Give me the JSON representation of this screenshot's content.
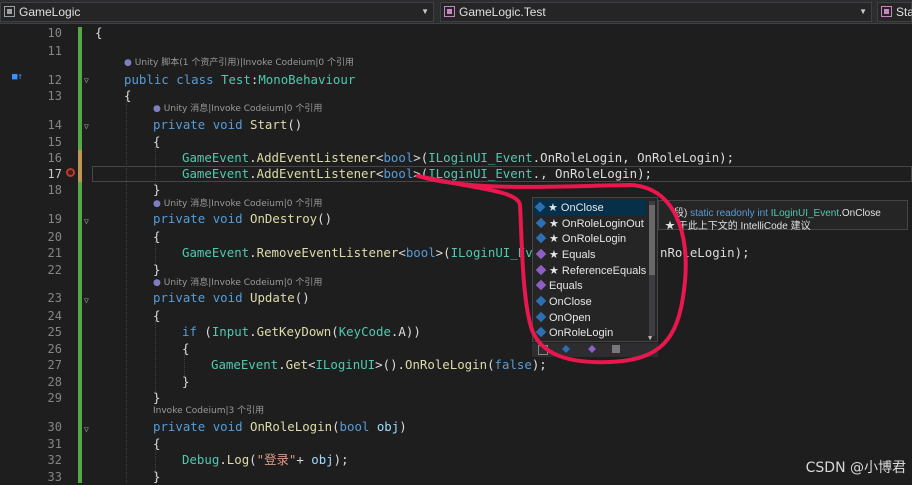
{
  "tabs": {
    "project": "GameLogic",
    "type": "GameLogic.Test",
    "member": "Sta"
  },
  "lines": [
    {
      "n": "10"
    },
    {
      "n": "11"
    },
    {
      "n": "12"
    },
    {
      "n": "13"
    },
    {
      "n": "14"
    },
    {
      "n": "15"
    },
    {
      "n": "16"
    },
    {
      "n": "17"
    },
    {
      "n": "18"
    },
    {
      "n": "19"
    },
    {
      "n": "20"
    },
    {
      "n": "21"
    },
    {
      "n": "22"
    },
    {
      "n": "23"
    },
    {
      "n": "24"
    },
    {
      "n": "25"
    },
    {
      "n": "26"
    },
    {
      "n": "27"
    },
    {
      "n": "28"
    },
    {
      "n": "29"
    },
    {
      "n": "30"
    },
    {
      "n": "31"
    },
    {
      "n": "32"
    },
    {
      "n": "33"
    }
  ],
  "lens": {
    "class": "Unity 脚本(1 个资产引用)|Invoke Codeium|0 个引用",
    "msg": "Unity 消息|Invoke Codeium|0 个引用",
    "refs3": "Invoke Codeium|3 个引用"
  },
  "code": {
    "brace_open": "{",
    "brace_close": "}",
    "public": "public",
    "class": "class",
    "test": "Test",
    "colon": ":",
    "mono": "MonoBehaviour",
    "private": "private",
    "void": "void",
    "start": "Start",
    "ondestroy": "OnDestroy",
    "update": "Update",
    "onrolelogin": "OnRoleLogin",
    "parens": "()",
    "gameevent": "GameEvent",
    "add": "AddEventListener",
    "remove": "RemoveEventListener",
    "get": "Get",
    "bool": "bool",
    "iloginui_event": "ILoginUI_Event",
    "iloginui_eve": "ILoginUI_Eve",
    "iloginui": "ILoginUI",
    "onrolelogin_tail": "nRoleLogin",
    "if": "if",
    "input": "Input",
    "getkeydown": "GetKeyDown",
    "keycode": "KeyCode",
    "a": "A",
    "false": "false",
    "debug": "Debug",
    "log": "Log",
    "str": "\"登录\"",
    "obj": "obj"
  },
  "completion": {
    "items": [
      {
        "label": "★ OnClose",
        "kind": "field",
        "selected": true
      },
      {
        "label": "★ OnRoleLoginOut",
        "kind": "field",
        "selected": false
      },
      {
        "label": "★ OnRoleLogin",
        "kind": "field",
        "selected": false
      },
      {
        "label": "★ Equals",
        "kind": "method",
        "selected": false
      },
      {
        "label": "★ ReferenceEquals",
        "kind": "method",
        "selected": false
      },
      {
        "label": "Equals",
        "kind": "method",
        "selected": false
      },
      {
        "label": "OnClose",
        "kind": "field",
        "selected": false
      },
      {
        "label": "OnOpen",
        "kind": "field",
        "selected": false
      },
      {
        "label": "OnRoleLogin",
        "kind": "field",
        "selected": false
      }
    ]
  },
  "tooltip": {
    "frag": "段)",
    "sig_kw": "static readonly int",
    "sig_cls": "ILoginUI_Event",
    "sig_member": ".OnClose",
    "line2": "★  于此上下文的 IntelliCode 建议"
  },
  "watermark": "CSDN @小博君",
  "colors": {
    "keyword": "#569cd6",
    "type": "#4ec9b0",
    "method": "#dcdcaa",
    "param": "#9cdcfe",
    "string": "#d69d85",
    "annotation": "#e8174d"
  }
}
